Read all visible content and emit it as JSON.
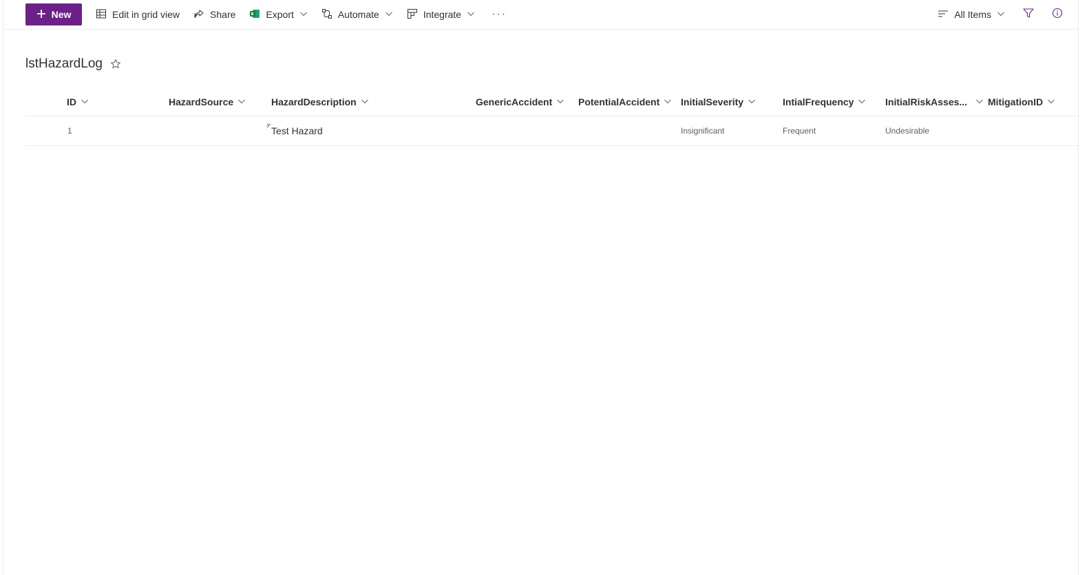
{
  "toolbar": {
    "new_label": "New",
    "edit_grid_label": "Edit in grid view",
    "share_label": "Share",
    "export_label": "Export",
    "automate_label": "Automate",
    "integrate_label": "Integrate",
    "more_label": "···",
    "view_label": "All Items"
  },
  "list": {
    "title": "lstHazardLog",
    "columns": [
      "ID",
      "HazardSource",
      "HazardDescription",
      "GenericAccident",
      "PotentialAccident",
      "InitialSeverity",
      "IntialFrequency",
      "InitialRiskAsses...",
      "MitigationID"
    ],
    "rows": [
      {
        "id": "1",
        "hazard_source": "",
        "hazard_description": "Test Hazard",
        "generic_accident": "",
        "potential_accident": "",
        "initial_severity": "Insignificant",
        "initial_frequency": "Frequent",
        "initial_risk": "Undesirable",
        "mitigation_id": ""
      }
    ]
  },
  "colors": {
    "accent": "#6b2187",
    "excel_green": "#107c41"
  },
  "icons": {
    "new": "plus-icon",
    "grid": "grid-icon",
    "share": "share-icon",
    "export": "excel-icon",
    "automate": "flow-icon",
    "integrate": "integrate-icon",
    "view": "lines-icon",
    "filter": "filter-icon",
    "info": "info-icon",
    "favorite": "star-icon"
  }
}
